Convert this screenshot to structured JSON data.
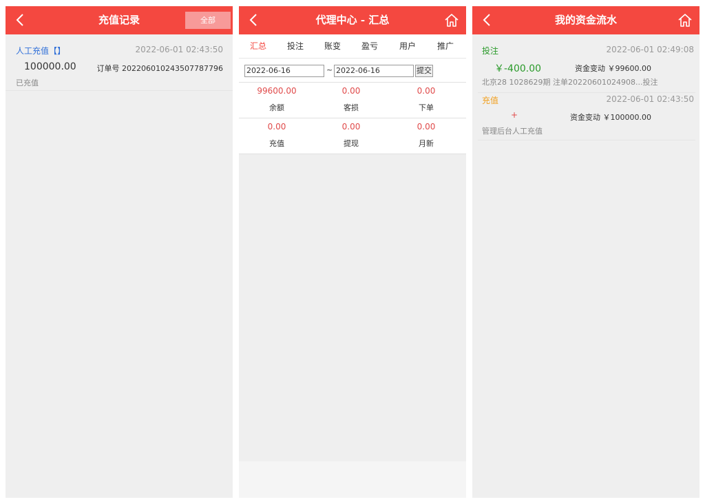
{
  "colors": {
    "header": "#f44840",
    "link": "#2f6fd8",
    "green": "#2a9a2a",
    "orange": "#f0a020",
    "red_value": "#e04a4a"
  },
  "panel1": {
    "title": "充值记录",
    "all_label": "全部",
    "record": {
      "type": "人工充值【】",
      "time": "2022-06-01 02:43:50",
      "amount": "100000.00",
      "order": "订单号 202206010243507787796",
      "status": "已充值"
    }
  },
  "panel2": {
    "title": "代理中心 - 汇总",
    "tabs": [
      "汇总",
      "投注",
      "账变",
      "盈亏",
      "用户",
      "推广"
    ],
    "date_from": "2022-06-16",
    "date_to": "2022-06-16",
    "tilde": "~",
    "submit_label": "提交",
    "stats": [
      {
        "value": "99600.00",
        "label": "余额"
      },
      {
        "value": "0.00",
        "label": "客损"
      },
      {
        "value": "0.00",
        "label": "下单"
      },
      {
        "value": "0.00",
        "label": "充值"
      },
      {
        "value": "0.00",
        "label": "提现"
      },
      {
        "value": "0.00",
        "label": "月新"
      }
    ]
  },
  "panel3": {
    "title": "我的资金流水",
    "items": [
      {
        "type": "投注",
        "time": "2022-06-01 02:49:08",
        "amount": "￥-400.00",
        "change": "资金变动 ￥99600.00",
        "desc": "北京28 1028629期 注单20220601024908...投注"
      },
      {
        "type": "充值",
        "time": "2022-06-01 02:43:50",
        "amount": "+",
        "change": "资金变动 ￥100000.00",
        "desc": "管理后台人工充值"
      }
    ]
  }
}
